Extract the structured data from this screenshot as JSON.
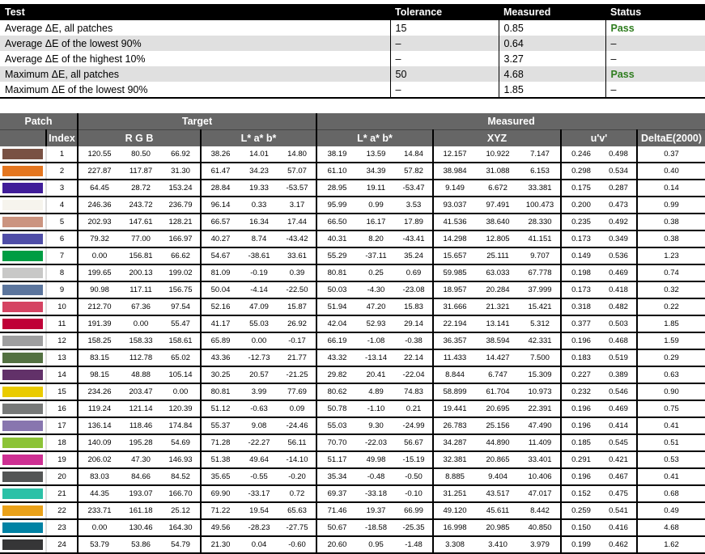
{
  "summary": {
    "headers": [
      "Test",
      "Tolerance",
      "Measured",
      "Status"
    ],
    "rows": [
      {
        "test": "Average ΔE, all patches",
        "tolerance": "15",
        "measured": "0.85",
        "status": "Pass"
      },
      {
        "test": "Average ΔE of the lowest 90%",
        "tolerance": "–",
        "measured": "0.64",
        "status": "–"
      },
      {
        "test": "Average ΔE of the highest 10%",
        "tolerance": "–",
        "measured": "3.27",
        "status": "–"
      },
      {
        "test": "Maximum ΔE, all patches",
        "tolerance": "50",
        "measured": "4.68",
        "status": "Pass"
      },
      {
        "test": "Maximum ΔE of the lowest 90%",
        "tolerance": "–",
        "measured": "1.85",
        "status": "–"
      }
    ],
    "pass_color": "#2e7d1e"
  },
  "patches": {
    "group_headers": {
      "patch": "Patch",
      "target": "Target",
      "measured": "Measured"
    },
    "sub_headers": {
      "index": "Index",
      "target_rgb": "R G B",
      "target_lab": "L* a* b*",
      "measured_lab": "L* a* b*",
      "xyz": "XYZ",
      "uv": "u'v'",
      "delta": "DeltaE(2000)"
    },
    "rows": [
      {
        "i": "1",
        "rgb": [
          "120.55",
          "80.50",
          "66.92"
        ],
        "tlab": [
          "38.26",
          "14.01",
          "14.80"
        ],
        "mlab": [
          "38.19",
          "13.59",
          "14.84"
        ],
        "xyz": [
          "12.157",
          "10.922",
          "7.147"
        ],
        "uv": [
          "0.246",
          "0.498"
        ],
        "de": "0.37"
      },
      {
        "i": "2",
        "rgb": [
          "227.87",
          "117.87",
          "31.30"
        ],
        "tlab": [
          "61.47",
          "34.23",
          "57.07"
        ],
        "mlab": [
          "61.10",
          "34.39",
          "57.82"
        ],
        "xyz": [
          "38.984",
          "31.088",
          "6.153"
        ],
        "uv": [
          "0.298",
          "0.534"
        ],
        "de": "0.40"
      },
      {
        "i": "3",
        "rgb": [
          "64.45",
          "28.72",
          "153.24"
        ],
        "tlab": [
          "28.84",
          "19.33",
          "-53.57"
        ],
        "mlab": [
          "28.95",
          "19.11",
          "-53.47"
        ],
        "xyz": [
          "9.149",
          "6.672",
          "33.381"
        ],
        "uv": [
          "0.175",
          "0.287"
        ],
        "de": "0.14"
      },
      {
        "i": "4",
        "rgb": [
          "246.36",
          "243.72",
          "236.79"
        ],
        "tlab": [
          "96.14",
          "0.33",
          "3.17"
        ],
        "mlab": [
          "95.99",
          "0.99",
          "3.53"
        ],
        "xyz": [
          "93.037",
          "97.491",
          "100.473"
        ],
        "uv": [
          "0.200",
          "0.473"
        ],
        "de": "0.99"
      },
      {
        "i": "5",
        "rgb": [
          "202.93",
          "147.61",
          "128.21"
        ],
        "tlab": [
          "66.57",
          "16.34",
          "17.44"
        ],
        "mlab": [
          "66.50",
          "16.17",
          "17.89"
        ],
        "xyz": [
          "41.536",
          "38.640",
          "28.330"
        ],
        "uv": [
          "0.235",
          "0.492"
        ],
        "de": "0.38"
      },
      {
        "i": "6",
        "rgb": [
          "79.32",
          "77.00",
          "166.97"
        ],
        "tlab": [
          "40.27",
          "8.74",
          "-43.42"
        ],
        "mlab": [
          "40.31",
          "8.20",
          "-43.41"
        ],
        "xyz": [
          "14.298",
          "12.805",
          "41.151"
        ],
        "uv": [
          "0.173",
          "0.349"
        ],
        "de": "0.38"
      },
      {
        "i": "7",
        "rgb": [
          "0.00",
          "156.81",
          "66.62"
        ],
        "tlab": [
          "54.67",
          "-38.61",
          "33.61"
        ],
        "mlab": [
          "55.29",
          "-37.11",
          "35.24"
        ],
        "xyz": [
          "15.657",
          "25.111",
          "9.707"
        ],
        "uv": [
          "0.149",
          "0.536"
        ],
        "de": "1.23"
      },
      {
        "i": "8",
        "rgb": [
          "199.65",
          "200.13",
          "199.02"
        ],
        "tlab": [
          "81.09",
          "-0.19",
          "0.39"
        ],
        "mlab": [
          "80.81",
          "0.25",
          "0.69"
        ],
        "xyz": [
          "59.985",
          "63.033",
          "67.778"
        ],
        "uv": [
          "0.198",
          "0.469"
        ],
        "de": "0.74"
      },
      {
        "i": "9",
        "rgb": [
          "90.98",
          "117.11",
          "156.75"
        ],
        "tlab": [
          "50.04",
          "-4.14",
          "-22.50"
        ],
        "mlab": [
          "50.03",
          "-4.30",
          "-23.08"
        ],
        "xyz": [
          "18.957",
          "20.284",
          "37.999"
        ],
        "uv": [
          "0.173",
          "0.418"
        ],
        "de": "0.32"
      },
      {
        "i": "10",
        "rgb": [
          "212.70",
          "67.36",
          "97.54"
        ],
        "tlab": [
          "52.16",
          "47.09",
          "15.87"
        ],
        "mlab": [
          "51.94",
          "47.20",
          "15.83"
        ],
        "xyz": [
          "31.666",
          "21.321",
          "15.421"
        ],
        "uv": [
          "0.318",
          "0.482"
        ],
        "de": "0.22"
      },
      {
        "i": "11",
        "rgb": [
          "191.39",
          "0.00",
          "55.47"
        ],
        "tlab": [
          "41.17",
          "55.03",
          "26.92"
        ],
        "mlab": [
          "42.04",
          "52.93",
          "29.14"
        ],
        "xyz": [
          "22.194",
          "13.141",
          "5.312"
        ],
        "uv": [
          "0.377",
          "0.503"
        ],
        "de": "1.85"
      },
      {
        "i": "12",
        "rgb": [
          "158.25",
          "158.33",
          "158.61"
        ],
        "tlab": [
          "65.89",
          "0.00",
          "-0.17"
        ],
        "mlab": [
          "66.19",
          "-1.08",
          "-0.38"
        ],
        "xyz": [
          "36.357",
          "38.594",
          "42.331"
        ],
        "uv": [
          "0.196",
          "0.468"
        ],
        "de": "1.59"
      },
      {
        "i": "13",
        "rgb": [
          "83.15",
          "112.78",
          "65.02"
        ],
        "tlab": [
          "43.36",
          "-12.73",
          "21.77"
        ],
        "mlab": [
          "43.32",
          "-13.14",
          "22.14"
        ],
        "xyz": [
          "11.433",
          "14.427",
          "7.500"
        ],
        "uv": [
          "0.183",
          "0.519"
        ],
        "de": "0.29"
      },
      {
        "i": "14",
        "rgb": [
          "98.15",
          "48.88",
          "105.14"
        ],
        "tlab": [
          "30.25",
          "20.57",
          "-21.25"
        ],
        "mlab": [
          "29.82",
          "20.41",
          "-22.04"
        ],
        "xyz": [
          "8.844",
          "6.747",
          "15.309"
        ],
        "uv": [
          "0.227",
          "0.389"
        ],
        "de": "0.63"
      },
      {
        "i": "15",
        "rgb": [
          "234.26",
          "203.47",
          "0.00"
        ],
        "tlab": [
          "80.81",
          "3.99",
          "77.69"
        ],
        "mlab": [
          "80.62",
          "4.89",
          "74.83"
        ],
        "xyz": [
          "58.899",
          "61.704",
          "10.973"
        ],
        "uv": [
          "0.232",
          "0.546"
        ],
        "de": "0.90"
      },
      {
        "i": "16",
        "rgb": [
          "119.24",
          "121.14",
          "120.39"
        ],
        "tlab": [
          "51.12",
          "-0.63",
          "0.09"
        ],
        "mlab": [
          "50.78",
          "-1.10",
          "0.21"
        ],
        "xyz": [
          "19.441",
          "20.695",
          "22.391"
        ],
        "uv": [
          "0.196",
          "0.469"
        ],
        "de": "0.75"
      },
      {
        "i": "17",
        "rgb": [
          "136.14",
          "118.46",
          "174.84"
        ],
        "tlab": [
          "55.37",
          "9.08",
          "-24.46"
        ],
        "mlab": [
          "55.03",
          "9.30",
          "-24.99"
        ],
        "xyz": [
          "26.783",
          "25.156",
          "47.490"
        ],
        "uv": [
          "0.196",
          "0.414"
        ],
        "de": "0.41"
      },
      {
        "i": "18",
        "rgb": [
          "140.09",
          "195.28",
          "54.69"
        ],
        "tlab": [
          "71.28",
          "-22.27",
          "56.11"
        ],
        "mlab": [
          "70.70",
          "-22.03",
          "56.67"
        ],
        "xyz": [
          "34.287",
          "44.890",
          "11.409"
        ],
        "uv": [
          "0.185",
          "0.545"
        ],
        "de": "0.51"
      },
      {
        "i": "19",
        "rgb": [
          "206.02",
          "47.30",
          "146.93"
        ],
        "tlab": [
          "51.38",
          "49.64",
          "-14.10"
        ],
        "mlab": [
          "51.17",
          "49.98",
          "-15.19"
        ],
        "xyz": [
          "32.381",
          "20.865",
          "33.401"
        ],
        "uv": [
          "0.291",
          "0.421"
        ],
        "de": "0.53"
      },
      {
        "i": "20",
        "rgb": [
          "83.03",
          "84.66",
          "84.52"
        ],
        "tlab": [
          "35.65",
          "-0.55",
          "-0.20"
        ],
        "mlab": [
          "35.34",
          "-0.48",
          "-0.50"
        ],
        "xyz": [
          "8.885",
          "9.404",
          "10.406"
        ],
        "uv": [
          "0.196",
          "0.467"
        ],
        "de": "0.41"
      },
      {
        "i": "21",
        "rgb": [
          "44.35",
          "193.07",
          "166.70"
        ],
        "tlab": [
          "69.90",
          "-33.17",
          "0.72"
        ],
        "mlab": [
          "69.37",
          "-33.18",
          "-0.10"
        ],
        "xyz": [
          "31.251",
          "43.517",
          "47.017"
        ],
        "uv": [
          "0.152",
          "0.475"
        ],
        "de": "0.68"
      },
      {
        "i": "22",
        "rgb": [
          "233.71",
          "161.18",
          "25.12"
        ],
        "tlab": [
          "71.22",
          "19.54",
          "65.63"
        ],
        "mlab": [
          "71.46",
          "19.37",
          "66.99"
        ],
        "xyz": [
          "49.120",
          "45.611",
          "8.442"
        ],
        "uv": [
          "0.259",
          "0.541"
        ],
        "de": "0.49"
      },
      {
        "i": "23",
        "rgb": [
          "0.00",
          "130.46",
          "164.30"
        ],
        "tlab": [
          "49.56",
          "-28.23",
          "-27.75"
        ],
        "mlab": [
          "50.67",
          "-18.58",
          "-25.35"
        ],
        "xyz": [
          "16.998",
          "20.985",
          "40.850"
        ],
        "uv": [
          "0.150",
          "0.416"
        ],
        "de": "4.68"
      },
      {
        "i": "24",
        "rgb": [
          "53.79",
          "53.86",
          "54.79"
        ],
        "tlab": [
          "21.30",
          "0.04",
          "-0.60"
        ],
        "mlab": [
          "20.60",
          "0.95",
          "-1.48"
        ],
        "xyz": [
          "3.308",
          "3.410",
          "3.979"
        ],
        "uv": [
          "0.199",
          "0.462"
        ],
        "de": "1.62"
      }
    ]
  }
}
